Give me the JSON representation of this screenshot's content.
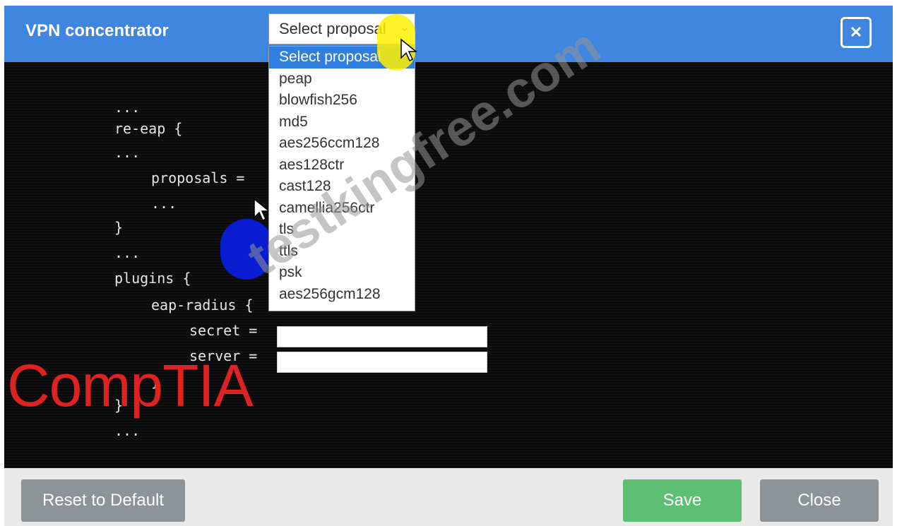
{
  "dialog": {
    "title": "VPN concentrator",
    "close_icon": "close-icon"
  },
  "proposal_select": {
    "value": "Select proposal",
    "options": [
      "Select proposal",
      "peap",
      "blowfish256",
      "md5",
      "aes256ccm128",
      "aes128ctr",
      "cast128",
      "camellia256ctr",
      "tls",
      "ttls",
      "psk",
      "aes256gcm128"
    ]
  },
  "code": {
    "l1": "...",
    "l2": "re-eap {",
    "l3": "...",
    "l4": "proposals =",
    "l5": "...",
    "l6": "}",
    "l7": "...",
    "l8": "plugins {",
    "l9": "eap-radius {",
    "l10": "secret =",
    "l11": "server =",
    "l12": "}",
    "l13": "}",
    "l14": "..."
  },
  "inputs": {
    "secret_value": "",
    "server_value": ""
  },
  "footer": {
    "reset_label": "Reset to Default",
    "save_label": "Save",
    "close_label": "Close"
  },
  "branding": {
    "logo_text": "CompTIA",
    "watermark_text": "testkingfree.com"
  },
  "colors": {
    "titlebar": "#3f86e0",
    "editor_bg": "#0b0b0b",
    "save": "#5cbf73",
    "neutral_button": "#8c9499",
    "selected_option": "#2e7fe0"
  }
}
